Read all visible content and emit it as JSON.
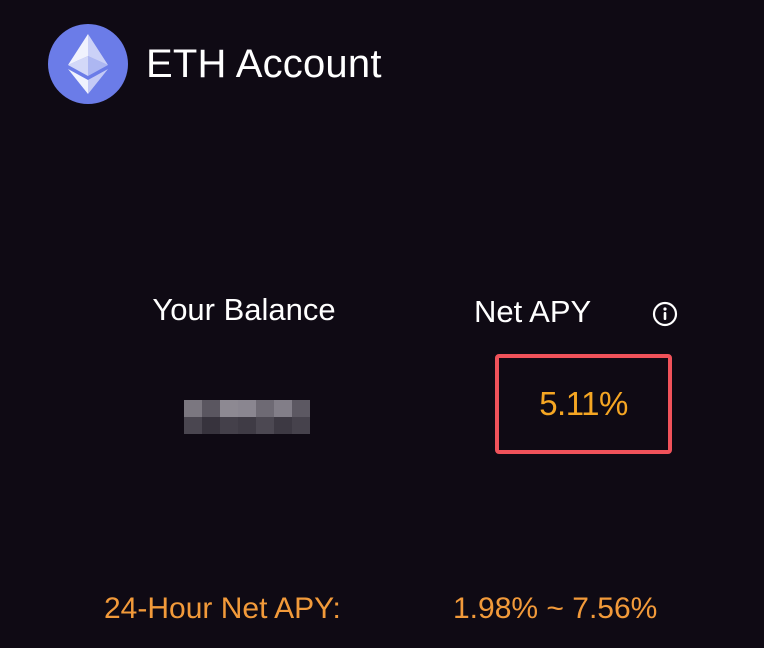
{
  "header": {
    "logo_icon": "ethereum-icon",
    "title": "ETH Account",
    "logo_bg": "#6b7ce8"
  },
  "balance": {
    "label": "Your Balance",
    "value_state": "pixelated"
  },
  "apy": {
    "label": "Net APY",
    "info_icon": "info-icon",
    "value": "5.11%",
    "value_color": "#f5a623",
    "highlight_color": "#f0525a"
  },
  "range": {
    "label": "24-Hour Net APY:",
    "value": "1.98% ~ 7.56%",
    "color": "#f29a3a"
  }
}
